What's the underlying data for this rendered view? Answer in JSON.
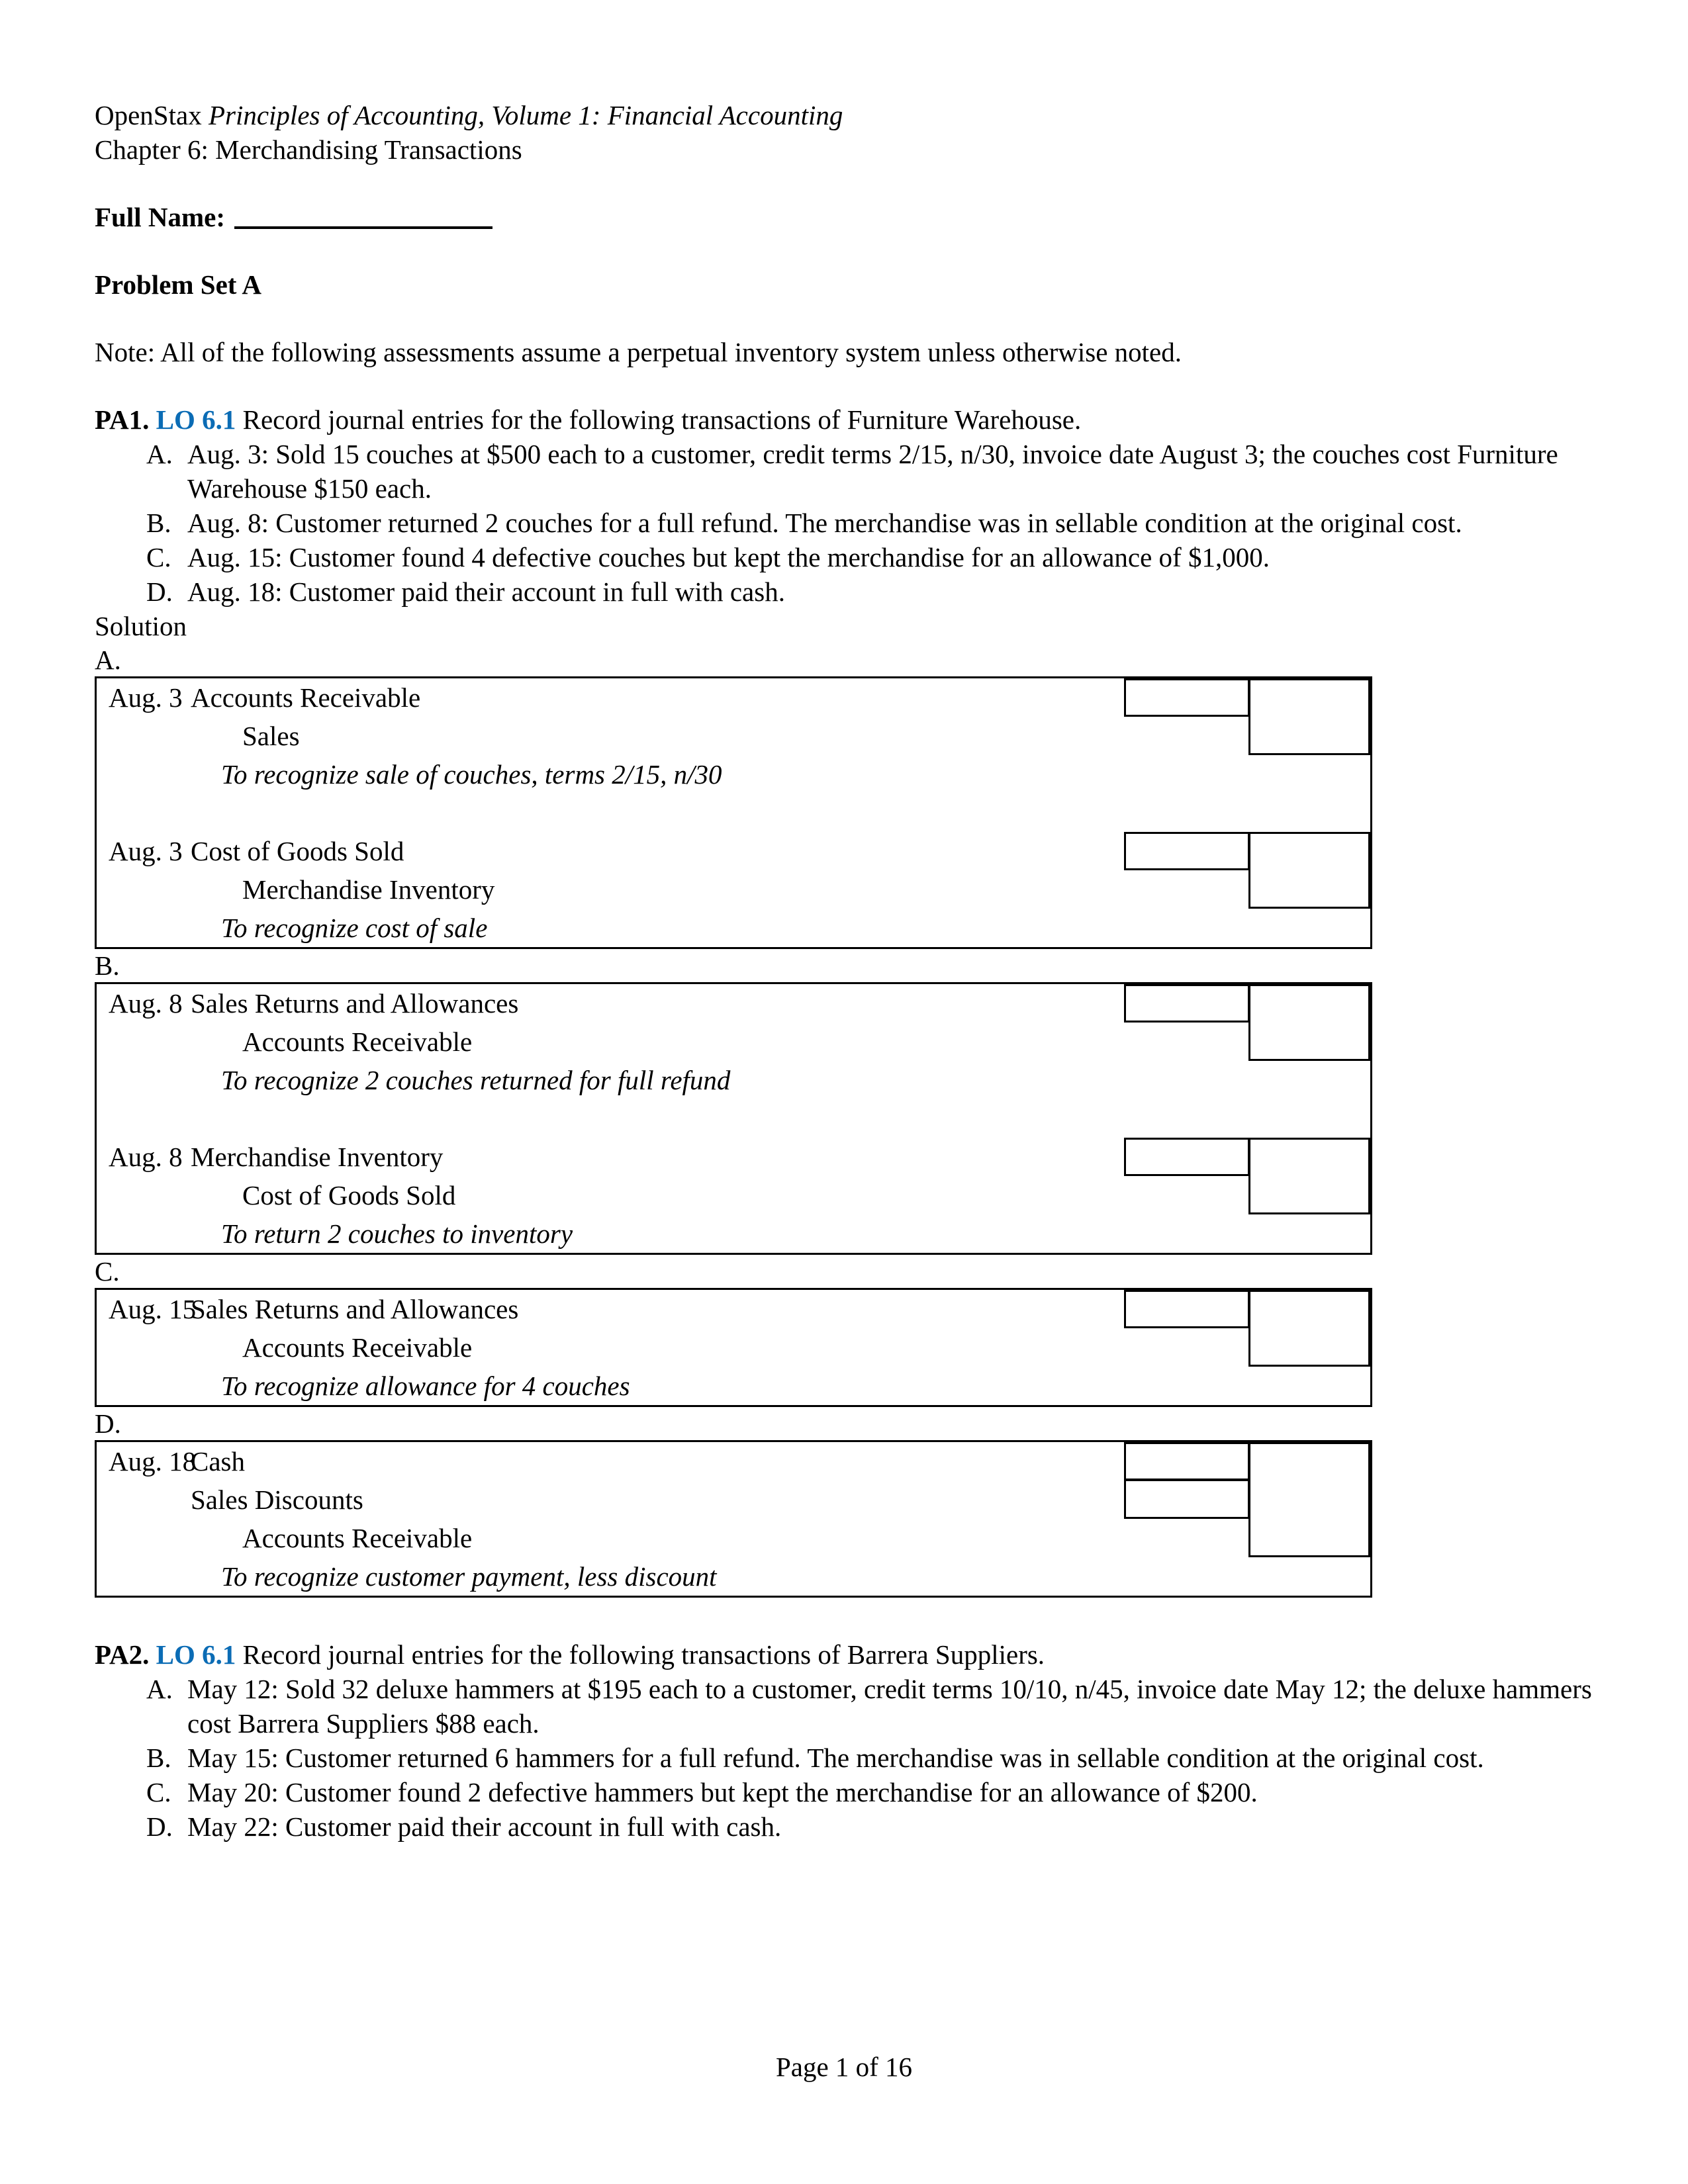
{
  "header": {
    "line1_prefix": "OpenStax ",
    "line1_italic": "Principles of Accounting, Volume 1: Financial Accounting",
    "line2": "Chapter 6: Merchandising Transactions"
  },
  "full_name": {
    "label": "Full Name:",
    "value": ""
  },
  "problem_set_title": "Problem Set A",
  "note": "Note: All of the following assessments assume a perpetual inventory system unless otherwise noted.",
  "problems": [
    {
      "id": "PA1.",
      "lo": "LO 6.1",
      "prompt": "Record journal entries for the following transactions of Furniture Warehouse.",
      "items": [
        {
          "mark": "A.",
          "text": "Aug. 3: Sold 15 couches at $500 each to a customer, credit terms 2/15, n/30, invoice date August 3; the couches cost Furniture Warehouse $150 each."
        },
        {
          "mark": "B.",
          "text": "Aug. 8: Customer returned 2 couches for a full refund. The merchandise was in sellable condition at the original cost."
        },
        {
          "mark": "C.",
          "text": "Aug. 15: Customer found 4 defective couches but kept the merchandise for an allowance of $1,000."
        },
        {
          "mark": "D.",
          "text": "Aug. 18: Customer paid their account in full with cash."
        }
      ]
    },
    {
      "id": "PA2.",
      "lo": "LO 6.1",
      "prompt": "Record journal entries for the following transactions of Barrera Suppliers.",
      "items": [
        {
          "mark": "A.",
          "text": "May 12: Sold 32 deluxe hammers at $195 each to a customer, credit terms 10/10, n/45, invoice date May 12; the deluxe hammers cost Barrera Suppliers $88 each."
        },
        {
          "mark": "B.",
          "text": "May 15: Customer returned 6 hammers for a full refund. The merchandise was in sellable condition at the original cost."
        },
        {
          "mark": "C.",
          "text": "May 20: Customer found 2 defective hammers but kept the merchandise for an allowance of $200."
        },
        {
          "mark": "D.",
          "text": "May 22: Customer paid their account in full with cash."
        }
      ]
    }
  ],
  "solution_label": "Solution",
  "solution_blocks": [
    {
      "label": "A.",
      "entries": [
        {
          "date": "Aug. 3",
          "debit_account": "Accounts Receivable",
          "credit_account": "Sales",
          "memo": "To recognize sale of couches, terms 2/15, n/30",
          "debit_value": "",
          "credit_value": ""
        },
        {
          "date": "Aug. 3",
          "debit_account": "Cost of Goods Sold",
          "credit_account": "Merchandise Inventory",
          "memo": "To recognize cost of sale",
          "debit_value": "",
          "credit_value": ""
        }
      ]
    },
    {
      "label": "B.",
      "entries": [
        {
          "date": "Aug. 8",
          "debit_account": "Sales Returns and Allowances",
          "credit_account": "Accounts Receivable",
          "memo": "To recognize 2 couches returned for full refund",
          "debit_value": "",
          "credit_value": ""
        },
        {
          "date": "Aug. 8",
          "debit_account": "Merchandise Inventory",
          "credit_account": "Cost of Goods Sold",
          "memo": "To return 2 couches to inventory",
          "debit_value": "",
          "credit_value": ""
        }
      ]
    },
    {
      "label": "C.",
      "entries": [
        {
          "date": "Aug. 15",
          "debit_account": "Sales Returns and Allowances",
          "credit_account": "Accounts Receivable",
          "memo": "To recognize allowance for 4 couches",
          "debit_value": "",
          "credit_value": ""
        }
      ]
    },
    {
      "label": "D.",
      "entries": [
        {
          "date": "Aug. 18",
          "debit_account": "Cash",
          "debit_account2": "Sales Discounts",
          "credit_account": "Accounts Receivable",
          "memo": "To recognize customer payment, less discount",
          "debit_value": "",
          "debit_value2": "",
          "credit_value": ""
        }
      ]
    }
  ],
  "footer": "Page 1 of 16",
  "colors": {
    "lo_link": "#0B6CB5",
    "rule": "#000000",
    "page_background": "#FFFFFF"
  }
}
